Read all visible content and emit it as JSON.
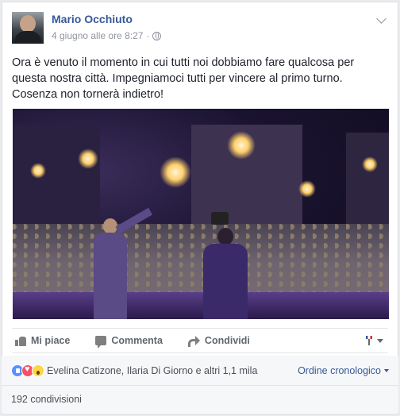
{
  "post": {
    "author": "Mario Occhiuto",
    "timestamp": "4 giugno alle ore 8:27",
    "separator": "·",
    "privacy_icon": "globe-icon",
    "menu_icon": "chevron-down-icon",
    "text": "Ora è venuto il momento in cui tutti noi dobbiamo fare qualcosa per questa nostra città. Impegniamoci tutti per vincere al primo turno. Cosenza non tornerà indietro!"
  },
  "actions": {
    "like_label": "Mi piace",
    "comment_label": "Commenta",
    "share_label": "Condividi"
  },
  "reactions": {
    "types": [
      "like",
      "love",
      "wow"
    ],
    "names": "Evelina Catizone, Ilaria Di Giorno e altri 1,1 mila",
    "sort_label": "Ordine cronologico"
  },
  "shares": {
    "label": "192 condivisioni"
  },
  "colors": {
    "link_blue": "#365899",
    "muted_gray": "#90949c",
    "page_bg": "#e9ebee"
  }
}
